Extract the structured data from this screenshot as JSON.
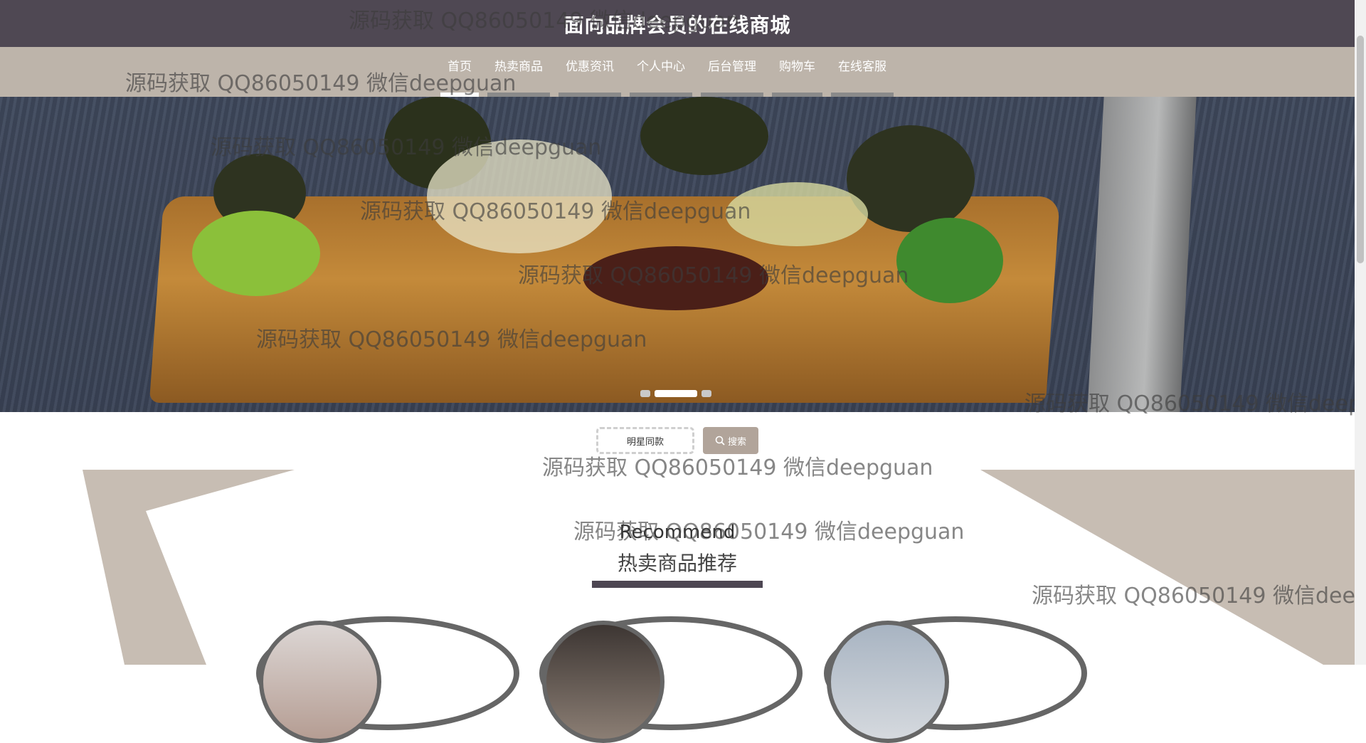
{
  "header": {
    "title": "面向品牌会员的在线商城"
  },
  "nav": {
    "items": [
      {
        "label": "首页",
        "active": true
      },
      {
        "label": "热卖商品"
      },
      {
        "label": "优惠资讯"
      },
      {
        "label": "个人中心"
      },
      {
        "label": "后台管理"
      },
      {
        "label": "购物车"
      },
      {
        "label": "在线客服"
      }
    ]
  },
  "carousel": {
    "slide_count": 3,
    "active_index": 1
  },
  "search": {
    "value": "明星同款",
    "button_label": "搜索"
  },
  "section": {
    "title_en": "Recommend",
    "title_cn": "热卖商品推荐"
  },
  "watermark": {
    "text": "源码获取 QQ86050149 微信deepguan"
  },
  "colors": {
    "topbar": "#4f4853",
    "navbar": "#bdb4aa",
    "accent": "#b1a49a"
  }
}
